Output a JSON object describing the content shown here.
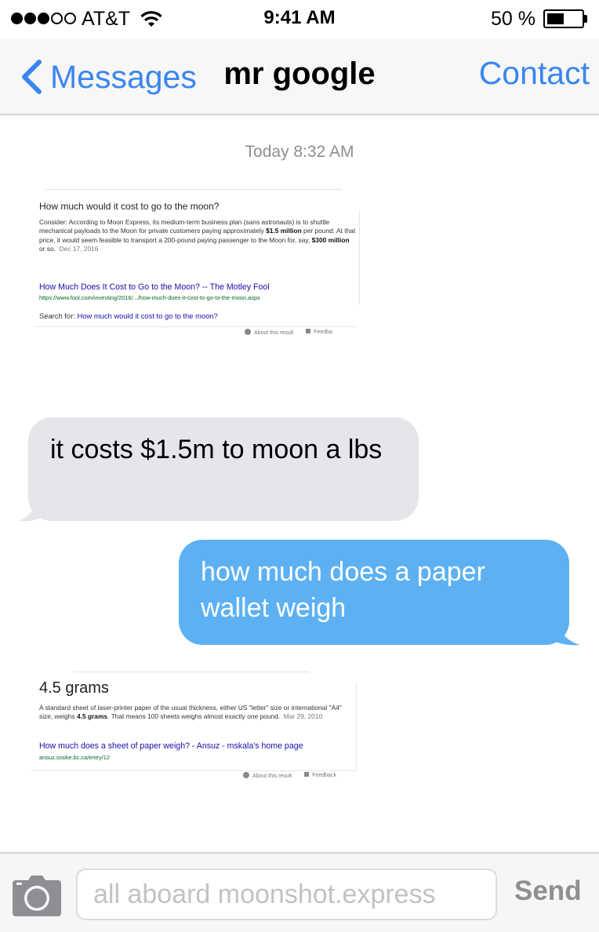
{
  "status_bar": {
    "carrier": "AT&T",
    "time": "9:41 AM",
    "battery_percent": "50 %",
    "battery_level": 0.5,
    "signal_bars_filled": 3,
    "signal_bars_total": 5,
    "icons": [
      "signal-dots",
      "wifi-icon",
      "battery-icon"
    ]
  },
  "nav": {
    "back_label": "Messages",
    "title": "mr google",
    "contact_label": "Contact",
    "accent_color": "#3a86f0"
  },
  "thread": {
    "timestamp": "Today 8:32 AM",
    "result1": {
      "question": "How much would it cost to go to the moon?",
      "snippet_a": "Consider: According to Moon Express, its medium-term business plan (sans astronauts) is to shuttle mechanical payloads to the Moon for private customers paying approximately ",
      "snippet_b1": "$1.5 million",
      "snippet_c": " per pound. At that price, it would seem feasible to transport a 200-pound paying passenger to the Moon for, say, ",
      "snippet_b2": "$300 million",
      "snippet_d": " or so.",
      "date": "Dec 17, 2016",
      "link": "How Much Does It Cost to Go to the Moon? -- The Motley Fool",
      "url": "https://www.fool.com/investing/2016/.../how-much-does-it-cost-to-go-to-the-moon.aspx",
      "search_for_label": "Search for:",
      "search_for_query": "How much would it cost to go to the moon?",
      "about": "About this result",
      "feedback": "Feedba"
    },
    "incoming_message": "it costs $1.5m to moon a lbs",
    "outgoing_message": "how much does a paper wallet weigh",
    "result2": {
      "answer": "4.5 grams",
      "snippet_a": "A standard sheet of laser-printer paper of the usual thickness, either US \"letter\" size or international \"A4\" size, weighs ",
      "snippet_b": "4.5 grams",
      "snippet_c": ". That means 100 sheets weighs almost exactly one pound.",
      "date": "Mar 29, 2010",
      "link": "How much does a sheet of paper weigh? - Ansuz - mskala's home page",
      "url": "ansuz.sooke.bc.ca/entry/12",
      "about": "About this result",
      "feedback": "Feedback"
    },
    "incoming_color": "#e5e5ea",
    "outgoing_color": "#5db1f3"
  },
  "composer": {
    "placeholder": "all aboard moonshot.express",
    "value": "",
    "send_label": "Send"
  }
}
